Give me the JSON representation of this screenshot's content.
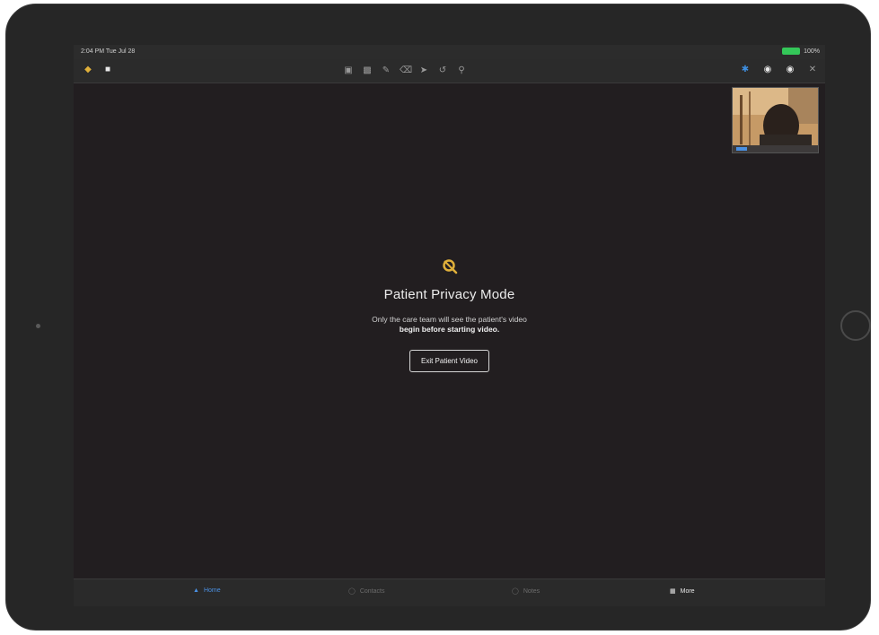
{
  "status": {
    "time": "2:04 PM Tue Jul 28",
    "battery": "100%"
  },
  "toolbar": {
    "left_icons": [
      "shield-icon",
      "chat-icon"
    ],
    "center_icons": [
      "video-icon",
      "monitor-icon",
      "pencil-icon",
      "eraser-icon",
      "cursor-icon",
      "undo-icon",
      "search-icon"
    ],
    "right_icons": [
      "bluetooth-icon",
      "shield-icon",
      "shield-icon",
      "close-icon"
    ]
  },
  "privacy": {
    "icon": "privacy-eye-off-icon",
    "accent": "#e0b03a",
    "title": "Patient Privacy Mode",
    "desc_line1": "Only the care team will see the patient's video",
    "desc_line2": "begin before starting video.",
    "button": "Exit Patient Video"
  },
  "tabs": [
    {
      "label": "Home",
      "icon": "home-icon"
    },
    {
      "label": "Contacts",
      "icon": "contacts-icon"
    },
    {
      "label": "Notes",
      "icon": "notes-icon"
    },
    {
      "label": "More",
      "icon": "more-icon"
    }
  ],
  "colors": {
    "background": "#221e20",
    "tab_active": "#4a90e2"
  }
}
